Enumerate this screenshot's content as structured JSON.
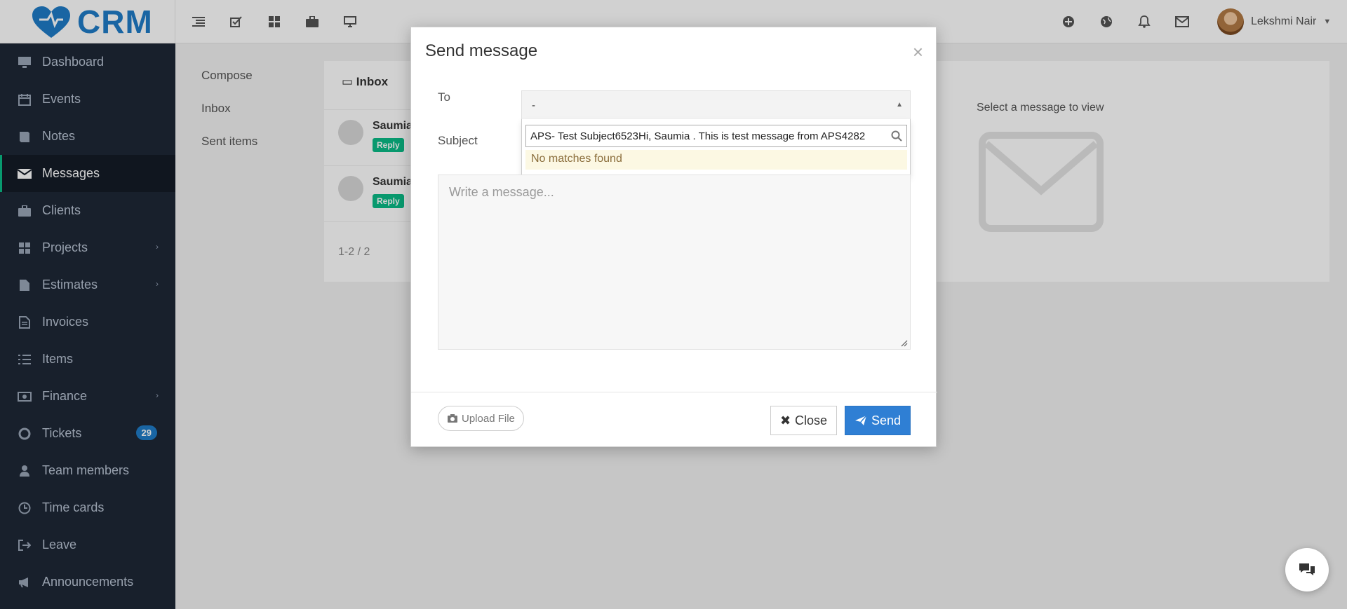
{
  "app": {
    "logo_text": "CRM"
  },
  "header": {
    "user_name": "Lekshmi Nair"
  },
  "sidebar": {
    "items": [
      {
        "label": "Dashboard",
        "icon": "monitor-icon"
      },
      {
        "label": "Events",
        "icon": "calendar-icon"
      },
      {
        "label": "Notes",
        "icon": "book-icon"
      },
      {
        "label": "Messages",
        "icon": "envelope-icon"
      },
      {
        "label": "Clients",
        "icon": "briefcase-icon"
      },
      {
        "label": "Projects",
        "icon": "grid-icon"
      },
      {
        "label": "Estimates",
        "icon": "file-icon"
      },
      {
        "label": "Invoices",
        "icon": "file-text-icon"
      },
      {
        "label": "Items",
        "icon": "list-icon"
      },
      {
        "label": "Finance",
        "icon": "money-icon"
      },
      {
        "label": "Tickets",
        "icon": "lifebuoy-icon",
        "badge": "29"
      },
      {
        "label": "Team members",
        "icon": "user-icon"
      },
      {
        "label": "Time cards",
        "icon": "clock-icon"
      },
      {
        "label": "Leave",
        "icon": "sign-out-icon"
      },
      {
        "label": "Announcements",
        "icon": "bullhorn-icon"
      }
    ]
  },
  "messages_nav": {
    "compose": "Compose",
    "inbox": "Inbox",
    "sent": "Sent items"
  },
  "inbox": {
    "title": "Inbox",
    "rows": [
      {
        "name": "Saumia",
        "badge": "Reply"
      },
      {
        "name": "Saumia",
        "badge": "Reply"
      }
    ],
    "pager": "1-2 / 2",
    "empty_text": "Select a message to view"
  },
  "modal": {
    "title": "Send message",
    "to_label": "To",
    "to_value": "-",
    "subject_label": "Subject",
    "search_value": "APS- Test Subject6523Hi, Saumia . This is test message from APS4282",
    "no_matches": "No matches found",
    "message_placeholder": "Write a message...",
    "upload_label": "Upload File",
    "close_label": "Close",
    "send_label": "Send"
  },
  "colors": {
    "brand": "#1f7cc7",
    "sidebar": "#1e2836",
    "accent_green": "#0abb87",
    "send": "#2f7fd4"
  }
}
